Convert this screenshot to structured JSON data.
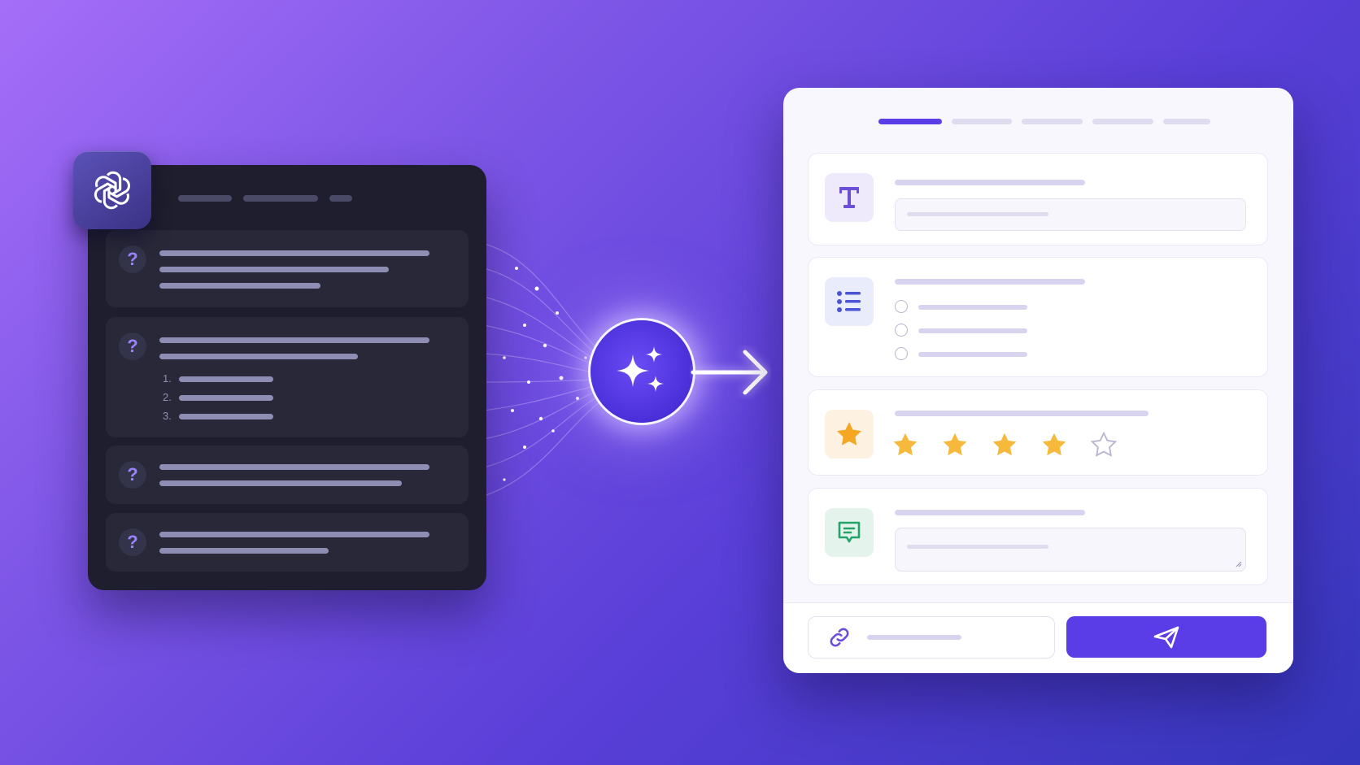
{
  "chat": {
    "logo_icon": "openai-logo-icon",
    "question_mark": "?",
    "list_numbers": [
      "1.",
      "2.",
      "3."
    ]
  },
  "center": {
    "icon": "sparkles-icon",
    "arrow_icon": "arrow-right-icon"
  },
  "form": {
    "steps_total": 5,
    "current_step": 1,
    "fields": [
      {
        "type": "text",
        "icon": "text-type-icon"
      },
      {
        "type": "multiple-choice",
        "icon": "list-icon",
        "options_count": 3
      },
      {
        "type": "rating",
        "icon": "star-icon",
        "rating": 4,
        "max": 5
      },
      {
        "type": "long-text",
        "icon": "comment-icon"
      }
    ],
    "footer": {
      "link_icon": "link-icon",
      "send_icon": "send-icon"
    }
  },
  "colors": {
    "accent": "#5a3de6",
    "star": "#f6b93b",
    "chat_bg": "#1e1e2e"
  }
}
